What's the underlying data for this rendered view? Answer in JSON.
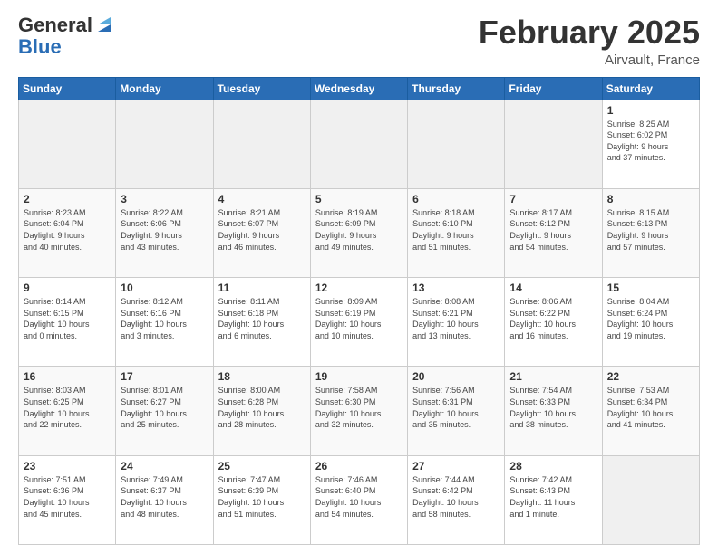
{
  "logo": {
    "general": "General",
    "blue": "Blue"
  },
  "title": "February 2025",
  "subtitle": "Airvault, France",
  "days_of_week": [
    "Sunday",
    "Monday",
    "Tuesday",
    "Wednesday",
    "Thursday",
    "Friday",
    "Saturday"
  ],
  "weeks": [
    [
      {
        "day": "",
        "info": ""
      },
      {
        "day": "",
        "info": ""
      },
      {
        "day": "",
        "info": ""
      },
      {
        "day": "",
        "info": ""
      },
      {
        "day": "",
        "info": ""
      },
      {
        "day": "",
        "info": ""
      },
      {
        "day": "1",
        "info": "Sunrise: 8:25 AM\nSunset: 6:02 PM\nDaylight: 9 hours\nand 37 minutes."
      }
    ],
    [
      {
        "day": "2",
        "info": "Sunrise: 8:23 AM\nSunset: 6:04 PM\nDaylight: 9 hours\nand 40 minutes."
      },
      {
        "day": "3",
        "info": "Sunrise: 8:22 AM\nSunset: 6:06 PM\nDaylight: 9 hours\nand 43 minutes."
      },
      {
        "day": "4",
        "info": "Sunrise: 8:21 AM\nSunset: 6:07 PM\nDaylight: 9 hours\nand 46 minutes."
      },
      {
        "day": "5",
        "info": "Sunrise: 8:19 AM\nSunset: 6:09 PM\nDaylight: 9 hours\nand 49 minutes."
      },
      {
        "day": "6",
        "info": "Sunrise: 8:18 AM\nSunset: 6:10 PM\nDaylight: 9 hours\nand 51 minutes."
      },
      {
        "day": "7",
        "info": "Sunrise: 8:17 AM\nSunset: 6:12 PM\nDaylight: 9 hours\nand 54 minutes."
      },
      {
        "day": "8",
        "info": "Sunrise: 8:15 AM\nSunset: 6:13 PM\nDaylight: 9 hours\nand 57 minutes."
      }
    ],
    [
      {
        "day": "9",
        "info": "Sunrise: 8:14 AM\nSunset: 6:15 PM\nDaylight: 10 hours\nand 0 minutes."
      },
      {
        "day": "10",
        "info": "Sunrise: 8:12 AM\nSunset: 6:16 PM\nDaylight: 10 hours\nand 3 minutes."
      },
      {
        "day": "11",
        "info": "Sunrise: 8:11 AM\nSunset: 6:18 PM\nDaylight: 10 hours\nand 6 minutes."
      },
      {
        "day": "12",
        "info": "Sunrise: 8:09 AM\nSunset: 6:19 PM\nDaylight: 10 hours\nand 10 minutes."
      },
      {
        "day": "13",
        "info": "Sunrise: 8:08 AM\nSunset: 6:21 PM\nDaylight: 10 hours\nand 13 minutes."
      },
      {
        "day": "14",
        "info": "Sunrise: 8:06 AM\nSunset: 6:22 PM\nDaylight: 10 hours\nand 16 minutes."
      },
      {
        "day": "15",
        "info": "Sunrise: 8:04 AM\nSunset: 6:24 PM\nDaylight: 10 hours\nand 19 minutes."
      }
    ],
    [
      {
        "day": "16",
        "info": "Sunrise: 8:03 AM\nSunset: 6:25 PM\nDaylight: 10 hours\nand 22 minutes."
      },
      {
        "day": "17",
        "info": "Sunrise: 8:01 AM\nSunset: 6:27 PM\nDaylight: 10 hours\nand 25 minutes."
      },
      {
        "day": "18",
        "info": "Sunrise: 8:00 AM\nSunset: 6:28 PM\nDaylight: 10 hours\nand 28 minutes."
      },
      {
        "day": "19",
        "info": "Sunrise: 7:58 AM\nSunset: 6:30 PM\nDaylight: 10 hours\nand 32 minutes."
      },
      {
        "day": "20",
        "info": "Sunrise: 7:56 AM\nSunset: 6:31 PM\nDaylight: 10 hours\nand 35 minutes."
      },
      {
        "day": "21",
        "info": "Sunrise: 7:54 AM\nSunset: 6:33 PM\nDaylight: 10 hours\nand 38 minutes."
      },
      {
        "day": "22",
        "info": "Sunrise: 7:53 AM\nSunset: 6:34 PM\nDaylight: 10 hours\nand 41 minutes."
      }
    ],
    [
      {
        "day": "23",
        "info": "Sunrise: 7:51 AM\nSunset: 6:36 PM\nDaylight: 10 hours\nand 45 minutes."
      },
      {
        "day": "24",
        "info": "Sunrise: 7:49 AM\nSunset: 6:37 PM\nDaylight: 10 hours\nand 48 minutes."
      },
      {
        "day": "25",
        "info": "Sunrise: 7:47 AM\nSunset: 6:39 PM\nDaylight: 10 hours\nand 51 minutes."
      },
      {
        "day": "26",
        "info": "Sunrise: 7:46 AM\nSunset: 6:40 PM\nDaylight: 10 hours\nand 54 minutes."
      },
      {
        "day": "27",
        "info": "Sunrise: 7:44 AM\nSunset: 6:42 PM\nDaylight: 10 hours\nand 58 minutes."
      },
      {
        "day": "28",
        "info": "Sunrise: 7:42 AM\nSunset: 6:43 PM\nDaylight: 11 hours\nand 1 minute."
      },
      {
        "day": "",
        "info": ""
      }
    ]
  ]
}
